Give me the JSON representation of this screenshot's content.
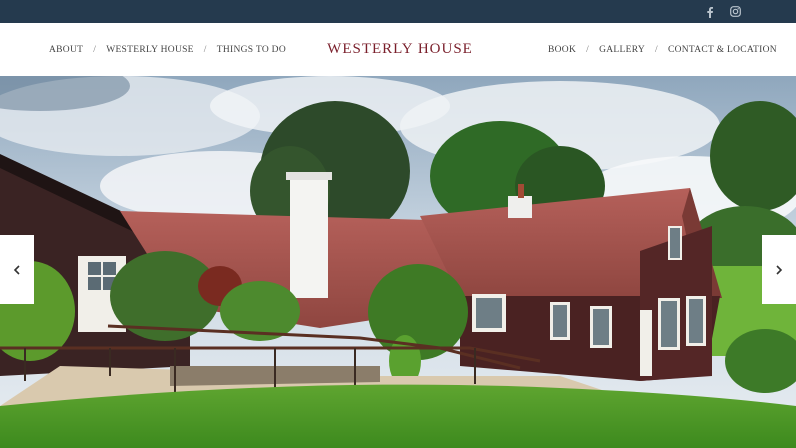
{
  "topbar": {
    "color": "#253a4e",
    "social": [
      {
        "icon": "facebook-icon"
      },
      {
        "icon": "instagram-icon"
      }
    ]
  },
  "nav": {
    "left": [
      "ABOUT",
      "WESTERLY HOUSE",
      "THINGS TO DO"
    ],
    "right": [
      "BOOK",
      "GALLERY",
      "CONTACT & LOCATION"
    ],
    "separator": "/"
  },
  "logo": {
    "text": "WESTERLY HOUSE",
    "color": "#7a1f2b"
  },
  "hero": {
    "prev_icon": "chevron-left-icon",
    "next_icon": "chevron-right-icon"
  }
}
